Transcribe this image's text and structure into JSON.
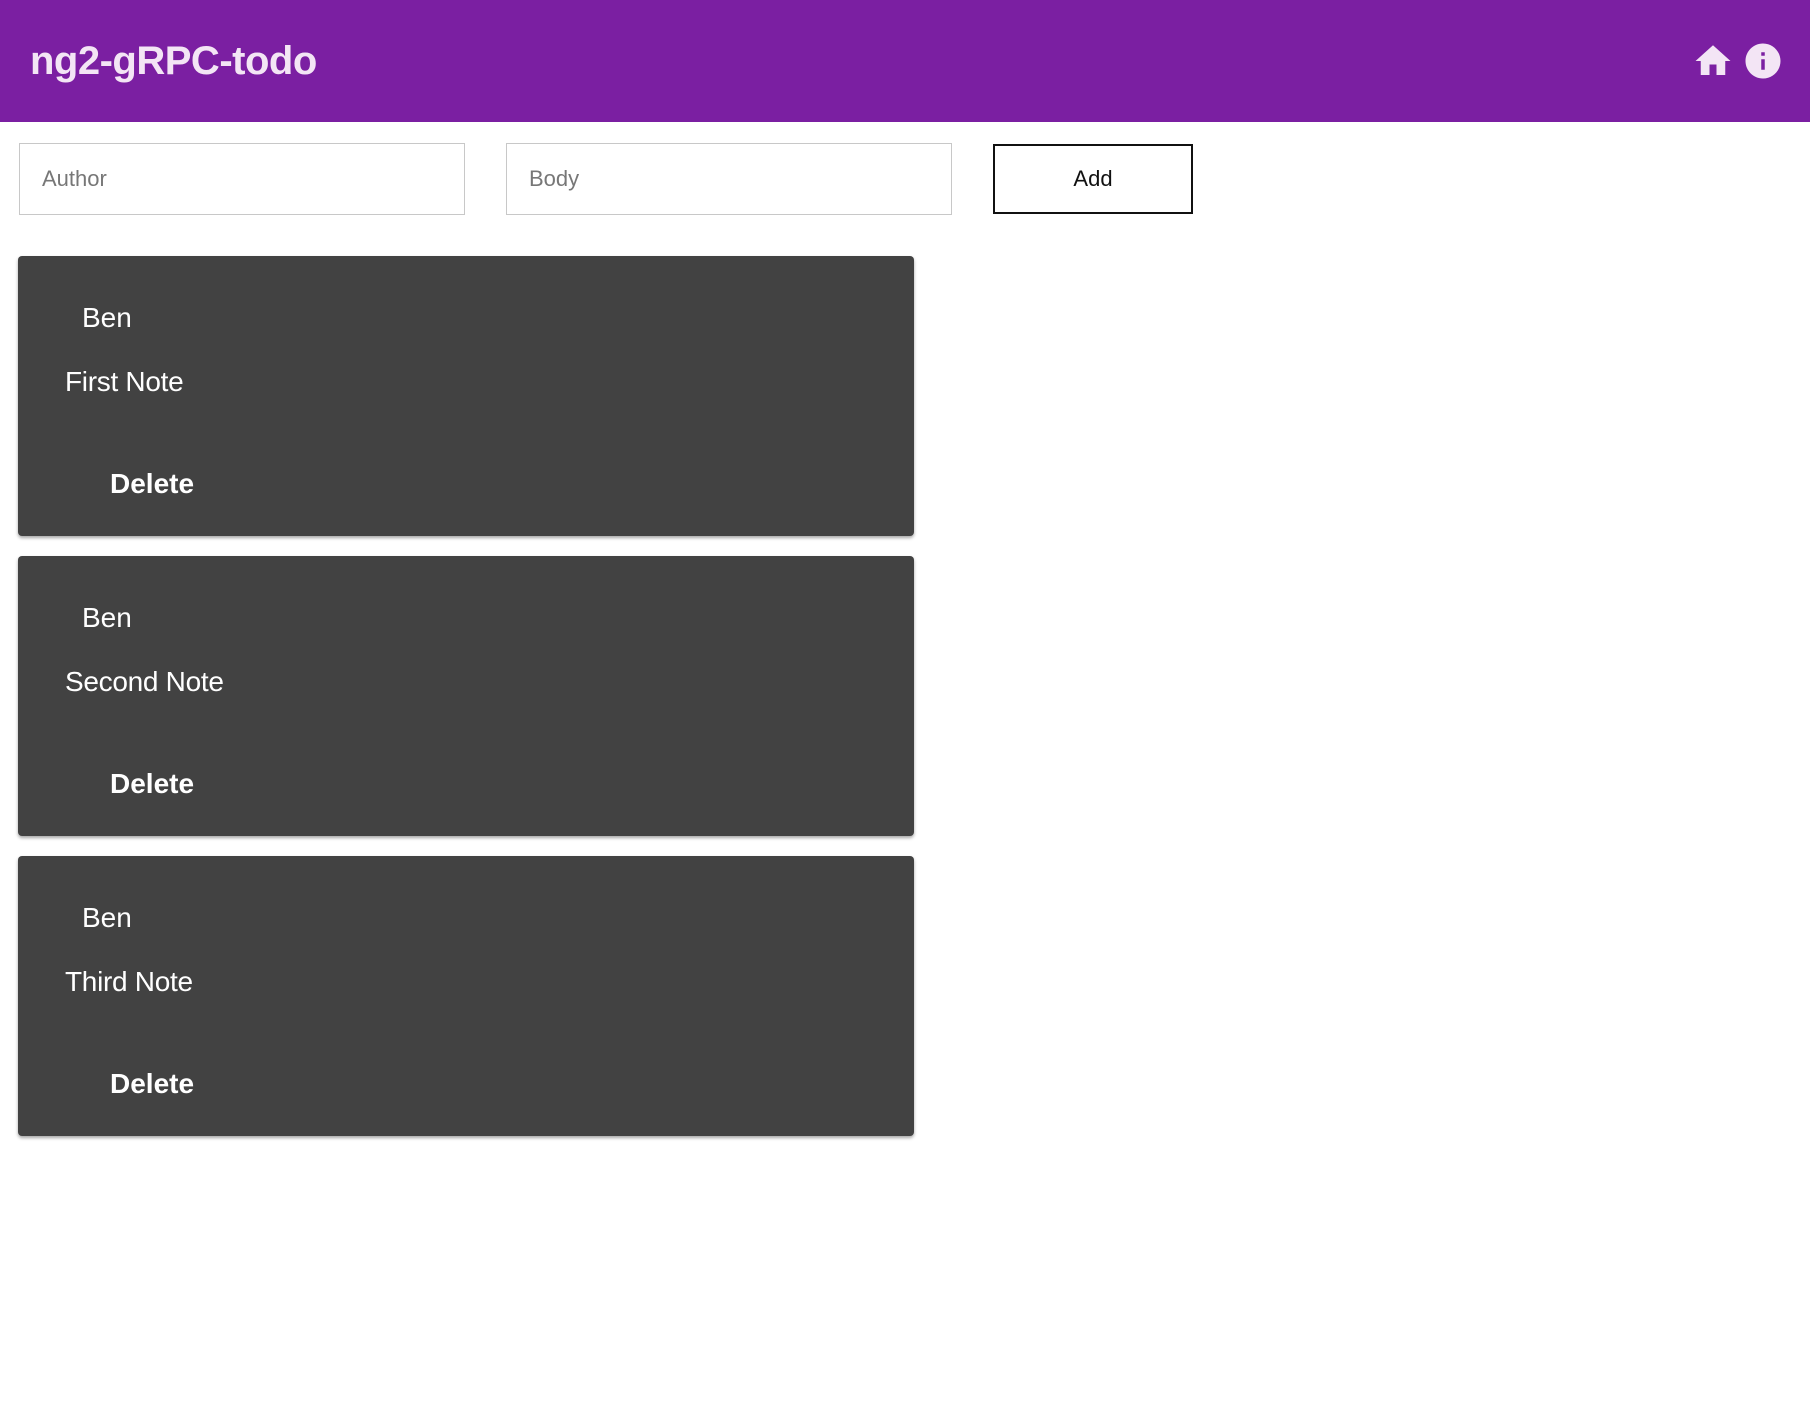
{
  "toolbar": {
    "title": "ng2-gRPC-todo",
    "icons": [
      "home-icon",
      "info-icon"
    ],
    "background_color": "#7b1fa2",
    "title_color": "#f3e5f5"
  },
  "form": {
    "author_placeholder": "Author",
    "author_value": "",
    "body_placeholder": "Body",
    "body_value": "",
    "add_label": "Add"
  },
  "notes": [
    {
      "author": "Ben",
      "body": "First Note",
      "delete_label": "Delete"
    },
    {
      "author": "Ben",
      "body": "Second Note",
      "delete_label": "Delete"
    },
    {
      "author": "Ben",
      "body": "Third Note",
      "delete_label": "Delete"
    }
  ],
  "card_color": "#424242"
}
